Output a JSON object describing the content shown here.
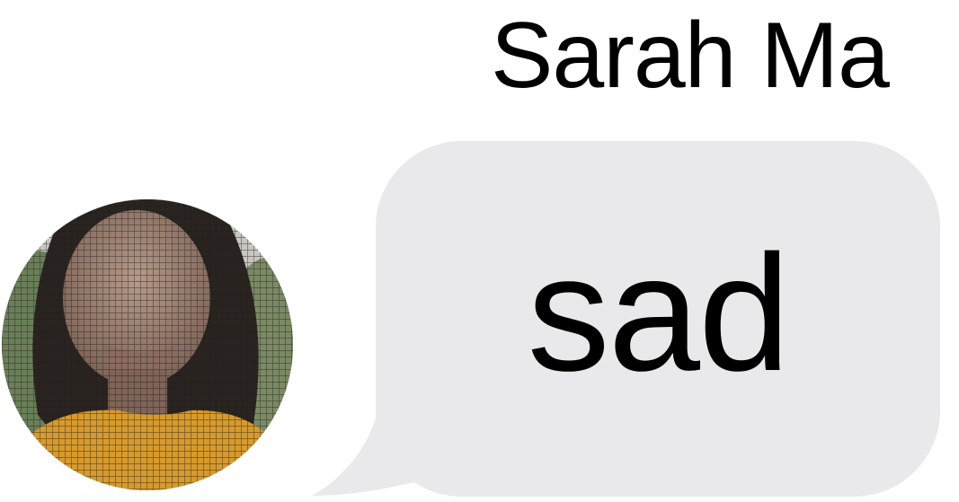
{
  "message": {
    "sender_name": "Sarah Ma",
    "text": "sad",
    "bubble_color": "#e9e9eb",
    "text_color": "#000000"
  },
  "avatar": {
    "icon": "profile-photo"
  }
}
